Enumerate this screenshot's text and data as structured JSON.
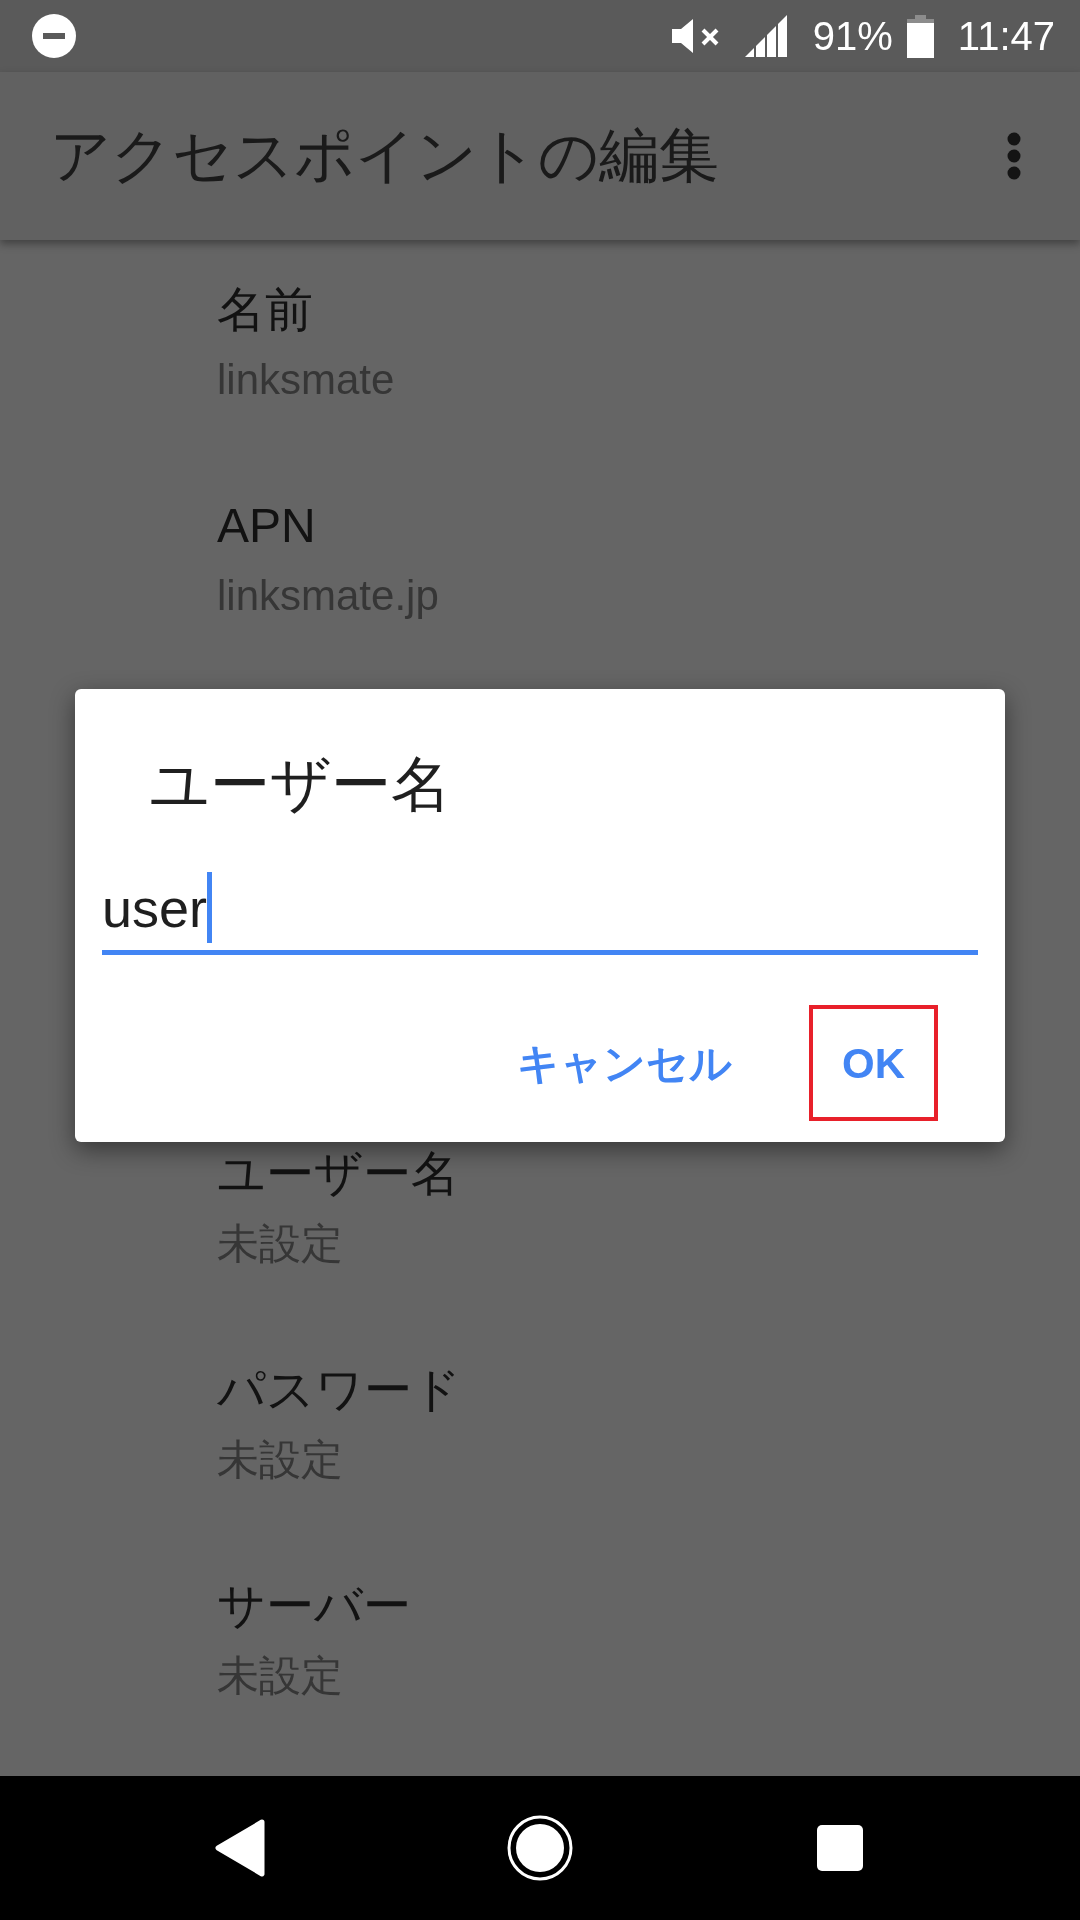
{
  "status_bar": {
    "battery": "91%",
    "time": "11:47"
  },
  "app_bar": {
    "title": "アクセスポイントの編集"
  },
  "settings": [
    {
      "label": "名前",
      "value": "linksmate"
    },
    {
      "label": "APN",
      "value": "linksmate.jp"
    },
    {
      "label": "ユーザー名",
      "value": "未設定"
    },
    {
      "label": "パスワード",
      "value": "未設定"
    },
    {
      "label": "サーバー",
      "value": "未設定"
    }
  ],
  "dialog": {
    "title": "ユーザー名",
    "input": {
      "value": "user",
      "focused": true
    },
    "buttons": [
      {
        "label": "キャンセル",
        "highlighted": false
      },
      {
        "label": "OK",
        "highlighted": true
      }
    ]
  }
}
